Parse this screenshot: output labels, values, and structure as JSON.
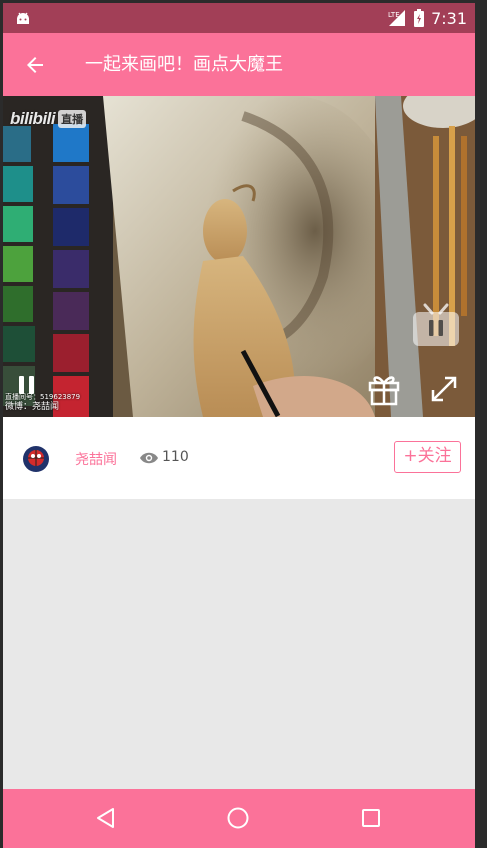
{
  "status_bar": {
    "time": "7:31",
    "network_label": "LTE",
    "icons": [
      "android-notification-icon",
      "signal-icon",
      "battery-icon"
    ]
  },
  "toolbar": {
    "title": "一起来画吧！画点大魔王",
    "back_icon": "arrow-back-icon"
  },
  "video": {
    "logo_text": "bilibili",
    "live_badge": "直播",
    "watermark_line1": "直播间号：519623879",
    "watermark_line2": "微博：尧喆闻",
    "controls": [
      "pause-icon",
      "tv-icon",
      "gift-icon",
      "fullscreen-icon"
    ]
  },
  "streamer": {
    "name": "尧喆闻",
    "view_count": "110",
    "follow_label": "+关注"
  },
  "nav_bar": {
    "buttons": [
      "back",
      "home",
      "recents"
    ]
  },
  "colors": {
    "accent": "#fb7299",
    "status_bar": "#a23f57",
    "background": "#e8e8e8"
  }
}
